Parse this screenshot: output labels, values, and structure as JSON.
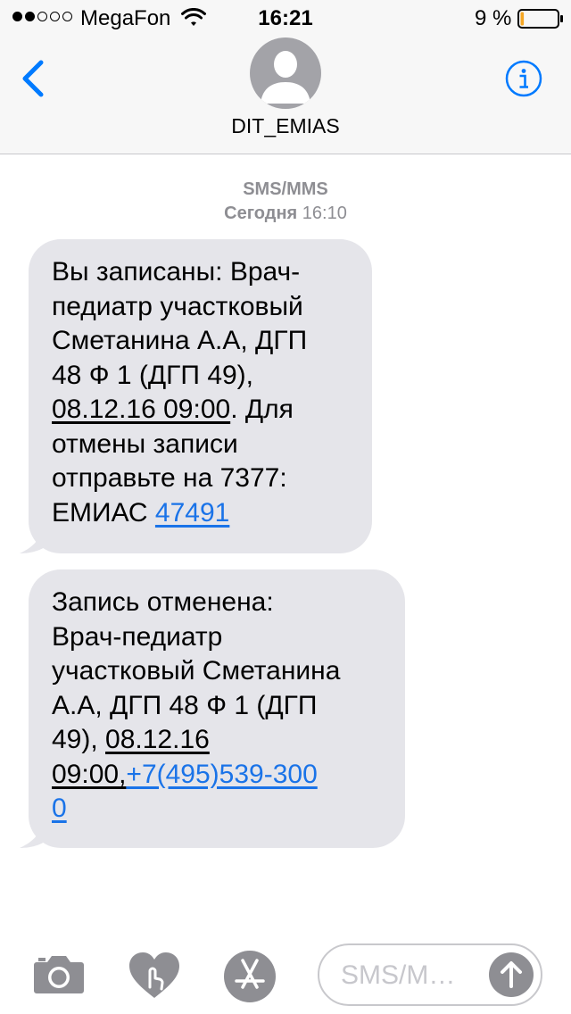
{
  "status_bar": {
    "carrier": "MegaFon",
    "time": "16:21",
    "battery_percent": "9 %",
    "battery_level": 0.09,
    "signal_bars_filled": 2,
    "signal_bars_total": 5
  },
  "header": {
    "contact_name": "DIT_EMIAS",
    "back_icon": "chevron-left-icon",
    "info_icon": "info-icon"
  },
  "thread": {
    "service": "SMS/MMS",
    "day": "Сегодня",
    "time": "16:10"
  },
  "messages": [
    {
      "lines": [
        "Вы записаны: Врач-",
        "педиатр участковый",
        "Сметанина А.А, ДГП",
        "48 Ф 1 (ДГП 49),"
      ],
      "date_time": "08.12.16 09:00",
      "after_date": ". Для",
      "lines2": [
        "отмены записи",
        "отправьте на 7377:"
      ],
      "last_prefix": "ЕМИАС ",
      "code_link": "47491"
    },
    {
      "lines": [
        "Запись отменена:",
        "Врач-педиатр",
        "участковый Сметанина",
        "А.А, ДГП 48 Ф 1 (ДГП"
      ],
      "line5_prefix": "49), ",
      "date": "08.12.16",
      "time_text": "09:00,",
      "phone_part1": "+7(495)539-300",
      "phone_part2": "0"
    }
  ],
  "toolbar": {
    "placeholder": "SMS/M…",
    "camera_icon": "camera-icon",
    "digital_touch_icon": "digital-touch-heart-icon",
    "app_store_icon": "app-store-icon",
    "send_icon": "arrow-up-icon"
  },
  "colors": {
    "accent": "#1a73e8",
    "bubble_gray": "#e5e5ea",
    "meta_gray": "#8e8e93",
    "bar_bg": "#f7f7f7"
  }
}
